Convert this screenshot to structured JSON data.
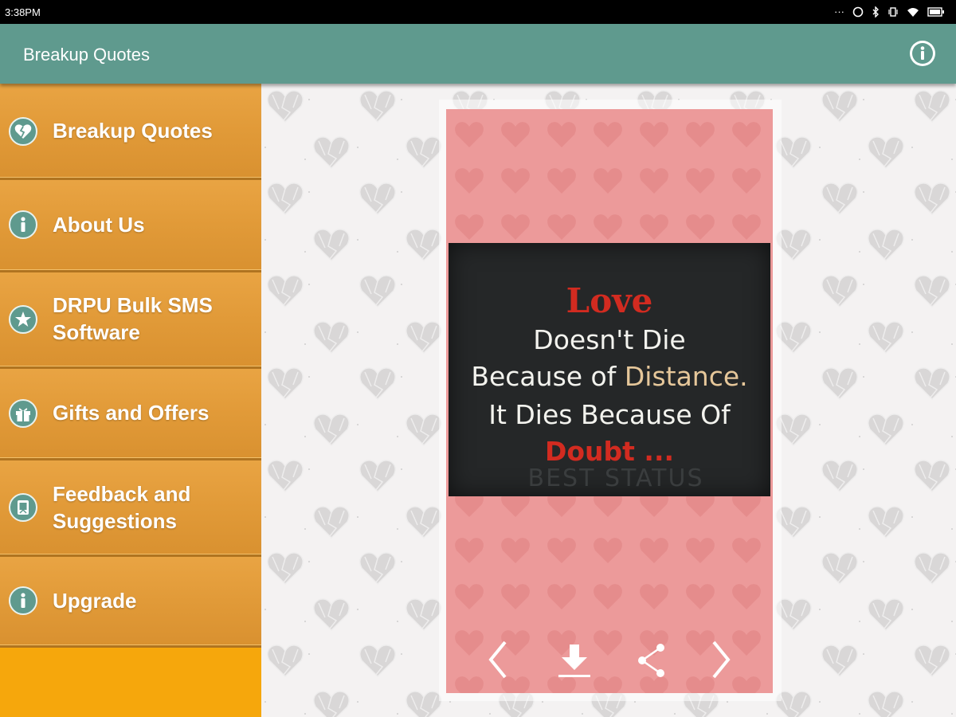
{
  "status_bar": {
    "time": "3:38PM"
  },
  "app_bar": {
    "title": "Breakup Quotes",
    "info_icon": "info-icon"
  },
  "sidebar": {
    "items": [
      {
        "label": "Breakup Quotes",
        "icon": "broken-heart-icon"
      },
      {
        "label": "About Us",
        "icon": "info-icon"
      },
      {
        "label": "DRPU Bulk SMS Software",
        "icon": "star-icon"
      },
      {
        "label": "Gifts and Offers",
        "icon": "gift-icon"
      },
      {
        "label": "Feedback and Suggestions",
        "icon": "feedback-icon"
      },
      {
        "label": "Upgrade",
        "icon": "info-icon"
      }
    ]
  },
  "quote": {
    "line1": "Love",
    "line2": "Doesn't Die",
    "line3_a": "Because of ",
    "line3_b": "Distance.",
    "line4": "It Dies Because Of",
    "line5": "Doubt ...",
    "watermark": "BEST STATUS"
  },
  "controls": {
    "prev": "chevron-left-icon",
    "download": "download-icon",
    "share": "share-icon",
    "next": "chevron-right-icon"
  },
  "colors": {
    "app_bar": "#5f9a8e",
    "sidebar_item": "#e19a38",
    "sidebar_bg": "#f6a70c",
    "card": "#ec9a9a",
    "quote_red": "#d22b20",
    "quote_accent": "#e6c79a"
  }
}
